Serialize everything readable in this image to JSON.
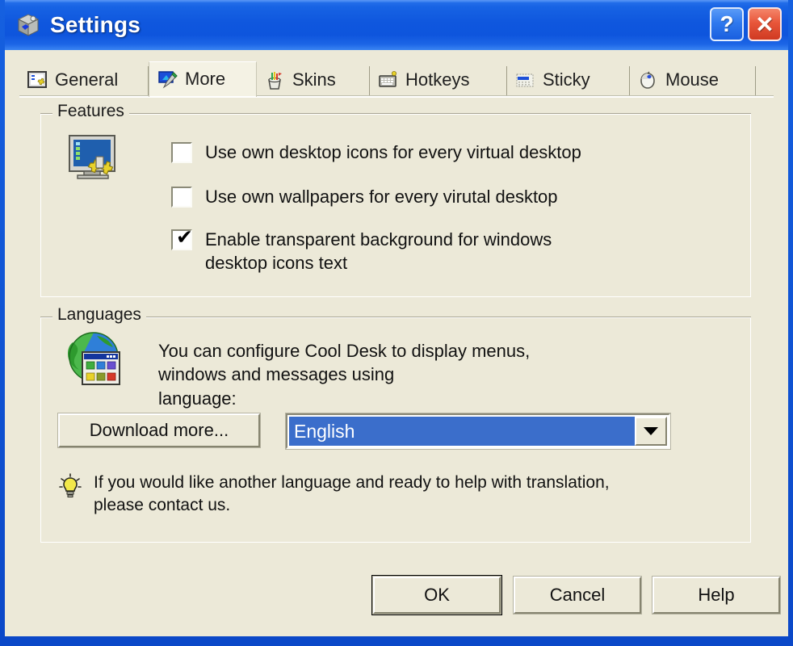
{
  "window": {
    "title": "Settings",
    "icon": "cube-settings-icon",
    "help_button_label": "?",
    "close_button_label": "✕"
  },
  "tabs": [
    {
      "label": "General",
      "icon": "monitor-gear-icon",
      "active": false
    },
    {
      "label": "More",
      "icon": "monitor-wand-icon",
      "active": true
    },
    {
      "label": "Skins",
      "icon": "paint-cup-icon",
      "active": false
    },
    {
      "label": "Hotkeys",
      "icon": "keyboard-icon",
      "active": false
    },
    {
      "label": "Sticky",
      "icon": "sticky-window-icon",
      "active": false
    },
    {
      "label": "Mouse",
      "icon": "mouse-icon",
      "active": false
    }
  ],
  "features": {
    "group_title": "Features",
    "icon": "monitor-gears-icon",
    "checkboxes": [
      {
        "label": "Use own desktop icons for every virtual desktop",
        "checked": false
      },
      {
        "label": "Use own wallpapers for every virutal desktop",
        "checked": false
      },
      {
        "label": "Enable transparent background for windows\ndesktop icons text",
        "checked": true
      }
    ],
    "check_mark": "✔"
  },
  "languages": {
    "group_title": "Languages",
    "icon": "globe-window-icon",
    "description": "You can configure Cool Desk to display menus,\nwindows and messages using\nlanguage:",
    "download_button": "Download more...",
    "selected_language": "English",
    "tip_icon": "lightbulb-icon",
    "tip_text": "If you would like another language and ready to help with translation,\nplease contact us."
  },
  "footer": {
    "ok_label": "OK",
    "cancel_label": "Cancel",
    "help_label": "Help"
  },
  "colors": {
    "title_bar_blue": "#0f57de",
    "dialog_face": "#ece9d8",
    "selection_blue": "#3b6ecb",
    "close_red": "#e8563a"
  }
}
